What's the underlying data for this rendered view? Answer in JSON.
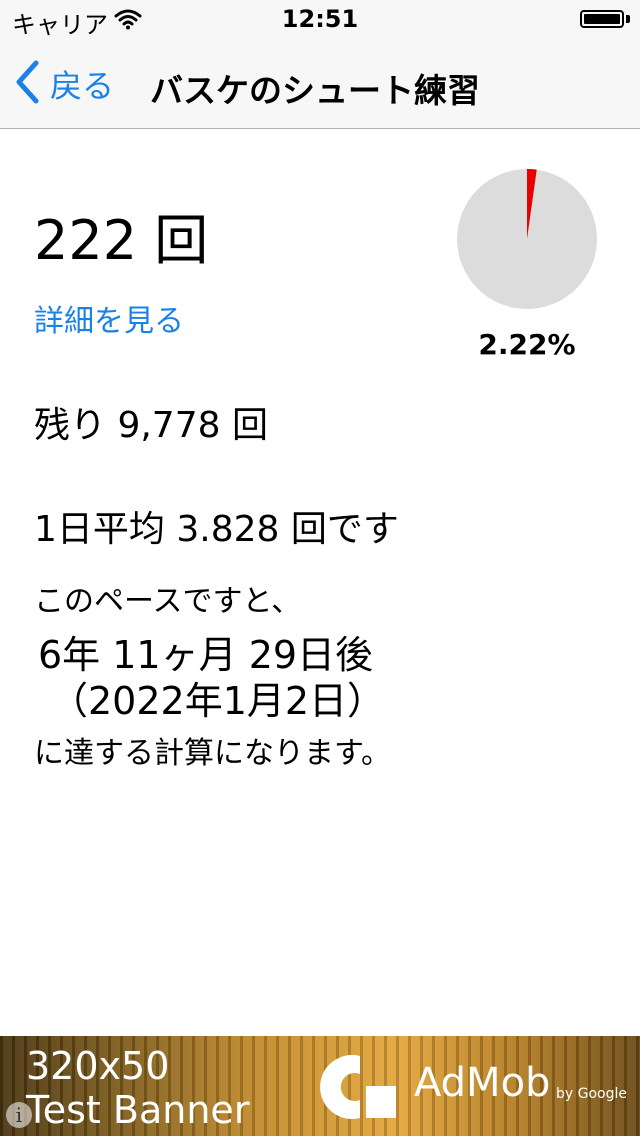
{
  "status_bar": {
    "carrier": "キャリア",
    "time": "12:51"
  },
  "nav": {
    "back_label": "戻る",
    "title": "バスケのシュート練習"
  },
  "stats": {
    "count": "222 回",
    "detail_link": "詳細を見る",
    "percent": "2.22%",
    "progress_percent": 2.22,
    "remaining": "残り 9,778 回",
    "daily_average": "1日平均 3.828 回です",
    "pace_intro": "このペースですと、",
    "duration": "6年 11ヶ月 29日後",
    "target_date": "（2022年1月2日）",
    "reach_text": "に達する計算になります。"
  },
  "ad": {
    "size": "320x50",
    "label": "Test Banner",
    "brand": "AdMob",
    "by": "by Google",
    "info": "i"
  },
  "colors": {
    "accent": "#1a82e6",
    "pie_fill": "#e60000",
    "pie_bg": "#dcdcdc"
  },
  "icons": {
    "wifi": "wifi-icon",
    "battery": "battery-icon",
    "back": "chevron-left-icon",
    "info": "info-icon",
    "admob": "admob-logo-icon"
  }
}
